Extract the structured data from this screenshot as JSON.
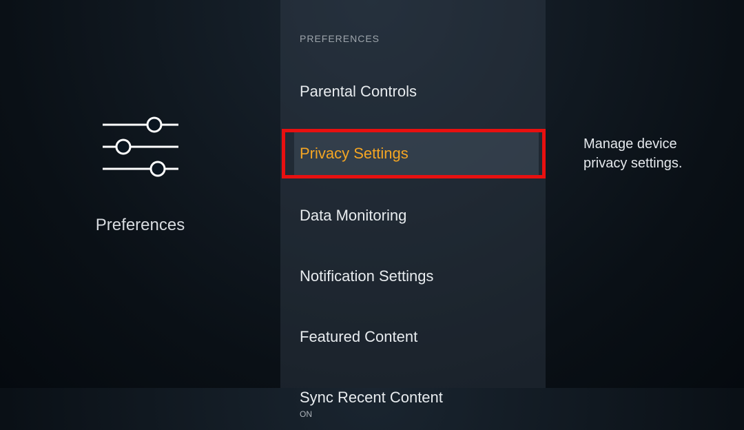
{
  "left": {
    "category": "Preferences"
  },
  "middle": {
    "header": "PREFERENCES",
    "items": [
      {
        "label": "Parental Controls",
        "sublabel": "",
        "selected": false
      },
      {
        "label": "Privacy Settings",
        "sublabel": "",
        "selected": true
      },
      {
        "label": "Data Monitoring",
        "sublabel": "",
        "selected": false
      },
      {
        "label": "Notification Settings",
        "sublabel": "",
        "selected": false
      },
      {
        "label": "Featured Content",
        "sublabel": "",
        "selected": false
      },
      {
        "label": "Sync Recent Content",
        "sublabel": "ON",
        "selected": false
      }
    ]
  },
  "right": {
    "description": "Manage device privacy settings."
  }
}
